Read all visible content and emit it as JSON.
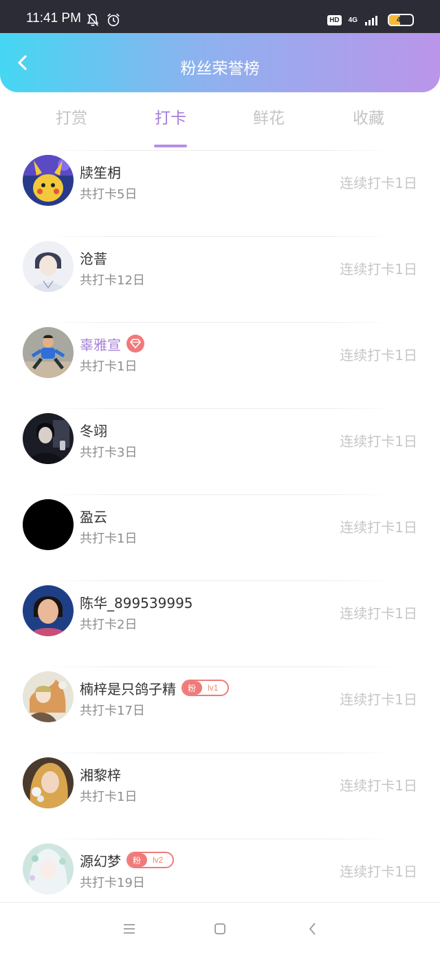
{
  "status_bar": {
    "time": "11:41 PM",
    "hd": "HD",
    "network": "4G",
    "battery": "47",
    "battery_level": 0.47
  },
  "header": {
    "title": "粉丝荣誉榜"
  },
  "tabs": [
    {
      "label": "打赏",
      "active": false
    },
    {
      "label": "打卡",
      "active": true
    },
    {
      "label": "鲜花",
      "active": false
    },
    {
      "label": "收藏",
      "active": false
    }
  ],
  "fans": [
    {
      "name": "牍笙枂",
      "total": "共打卡5日",
      "streak": "连续打卡1日"
    },
    {
      "name": "沧萻",
      "total": "共打卡12日",
      "streak": "连续打卡1日"
    },
    {
      "name": "辜雅宣",
      "total": "共打卡1日",
      "streak": "连续打卡1日",
      "vip": true
    },
    {
      "name": "冬翊",
      "total": "共打卡3日",
      "streak": "连续打卡1日"
    },
    {
      "name": "盈云",
      "total": "共打卡1日",
      "streak": "连续打卡1日"
    },
    {
      "name": "陈华_899539995",
      "total": "共打卡2日",
      "streak": "连续打卡1日"
    },
    {
      "name": "楠梓是只鸽子精",
      "total": "共打卡17日",
      "streak": "连续打卡1日",
      "badge_label": "粉",
      "badge_level": "lv1"
    },
    {
      "name": "湘黎梓",
      "total": "共打卡1日",
      "streak": "连续打卡1日"
    },
    {
      "name": "源幻梦",
      "total": "共打卡19日",
      "streak": "连续打卡1日",
      "badge_label": "粉",
      "badge_level": "lv2"
    }
  ],
  "colors": {
    "accent": "#a77dd9",
    "badge": "#f07a7a",
    "header_start": "#45d7f3",
    "header_end": "#bb95ea"
  }
}
